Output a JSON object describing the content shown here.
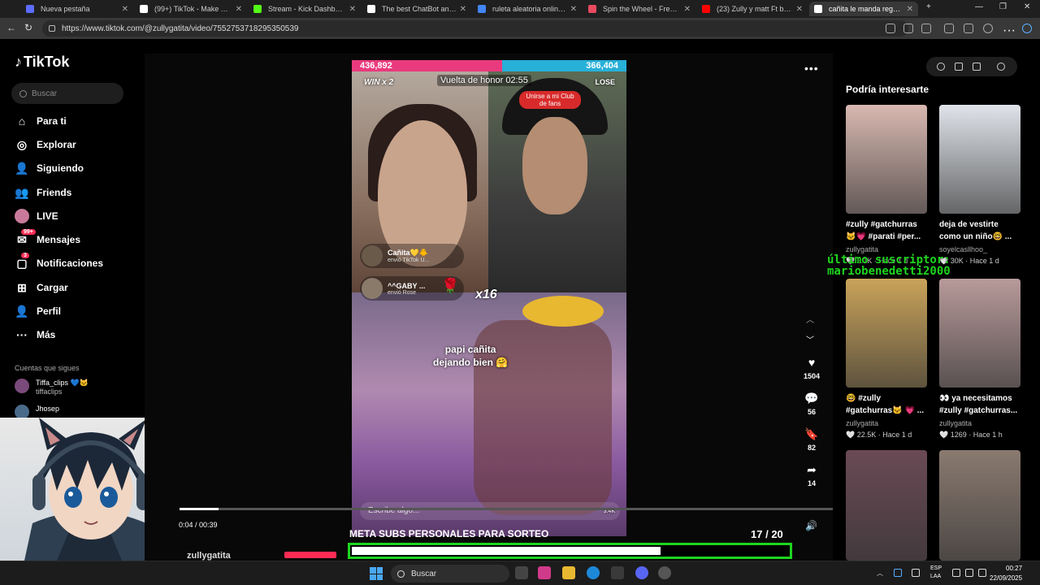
{
  "browser": {
    "tabs": [
      {
        "label": "Nueva pestaña",
        "color": "#5b6cff"
      },
      {
        "label": "(99+) TikTok - Make Your Da",
        "color": "#ffffff"
      },
      {
        "label": "Stream - Kick Dashboard",
        "color": "#53fc18"
      },
      {
        "label": "The best ChatBot and Widg",
        "color": "#ffffff"
      },
      {
        "label": "ruleta aleatoria online - Bú",
        "color": "#4285f4"
      },
      {
        "label": "Spin the Wheel - Free and",
        "color": "#e84a5f"
      },
      {
        "label": "(23) Zully y matt Ft baile in",
        "color": "#ff0000"
      },
      {
        "label": "cañita le manda regalos a",
        "color": "#ffffff"
      }
    ],
    "new_tab": "+",
    "url": "https://www.tiktok.com/@zullygatita/video/7552753718295350539"
  },
  "tiktok": {
    "logo": "TikTok",
    "search_placeholder": "Buscar",
    "nav": [
      {
        "label": "Para ti",
        "icon": "home-icon",
        "glyph": "⌂"
      },
      {
        "label": "Explorar",
        "icon": "compass-icon",
        "glyph": "◎"
      },
      {
        "label": "Siguiendo",
        "icon": "following-icon",
        "glyph": "👤"
      },
      {
        "label": "Friends",
        "icon": "friends-icon",
        "glyph": "👥"
      },
      {
        "label": "LIVE",
        "icon": "live-icon",
        "glyph": "●"
      },
      {
        "label": "Mensajes",
        "icon": "messages-icon",
        "glyph": "✉",
        "badge": "99+"
      },
      {
        "label": "Notificaciones",
        "icon": "bell-icon",
        "glyph": "▢",
        "badge": "3"
      },
      {
        "label": "Cargar",
        "icon": "upload-icon",
        "glyph": "⊞"
      },
      {
        "label": "Perfil",
        "icon": "profile-icon",
        "glyph": "👤"
      },
      {
        "label": "Más",
        "icon": "more-icon",
        "glyph": "···"
      }
    ],
    "following_header": "Cuentas que sigues",
    "following": [
      {
        "name": "Tiffa_clips 💙🐱",
        "handle": "tiffaclips"
      },
      {
        "name": "Jhosep",
        "handle": ""
      }
    ]
  },
  "video": {
    "score_left": "436,892",
    "score_right": "366,404",
    "win_label": "WIN x 2",
    "lose_label": "LOSE",
    "honor_label": "Vuelta de honor 02:55",
    "club_label": "Unirse a mi Club de fans",
    "gifts": [
      {
        "name": "Cañita💛🐥",
        "sub": "envió TikTok U..."
      },
      {
        "name": "^^GABY ...",
        "sub": "envió Rose"
      }
    ],
    "multiplier": "x16",
    "caption_line1": "papi cañita",
    "caption_line2": "dejando bien 🤗",
    "comment_placeholder": "Escribe algo...",
    "view_count": "3.4K",
    "progress_fraction": 0.06,
    "timecode": "0:04 / 00:39",
    "username": "zullygatita",
    "actions": [
      {
        "icon": "heart-icon",
        "glyph": "♥",
        "count": "1504"
      },
      {
        "icon": "comment-icon",
        "glyph": "💬",
        "count": "56"
      },
      {
        "icon": "bookmark-icon",
        "glyph": "🔖",
        "count": "82"
      },
      {
        "icon": "share-icon",
        "glyph": "➦",
        "count": "14"
      }
    ]
  },
  "goal": {
    "title": "META SUBS PERSONALES PARA SORTEO",
    "current": "17",
    "target": "/ 20",
    "fraction": 0.85,
    "color": "#1ed51e"
  },
  "recommendations": {
    "header": "Podría interesarte",
    "cards": [
      {
        "title": "#zully #gatchurras 🐱💗 #parati #per...",
        "user": "zullygatita",
        "meta": "🤍 3.1K · Hace 1 d",
        "color": "#d8b8b0"
      },
      {
        "title": "deja de vestirte como un niño🤓 ...",
        "user": "soyelcasllhoo_",
        "meta": "🤍 30K · Hace 1 d",
        "color": "#e0e4ea"
      },
      {
        "title": "🤓 #zully #gatchurras🐱 💗 ...",
        "user": "zullygatita",
        "meta": "🤍 22.5K · Hace 1 d",
        "color": "#c9a35a"
      },
      {
        "title": "👀 ya necesitamos #zully #gatchurras...",
        "user": "zullygatita",
        "meta": "🤍 1269 · Hace 1 h",
        "color": "#b89a9a"
      },
      {
        "title": "",
        "user": "",
        "meta": "",
        "color": "#6a4a55"
      },
      {
        "title": "",
        "user": "",
        "meta": "",
        "color": "#8a7a70"
      }
    ]
  },
  "overlay": {
    "last_sub_line1": "último suscriptor:",
    "last_sub_line2": "mariobenedetti2000"
  },
  "taskbar": {
    "search": "Buscar",
    "lang_line1": "ESP",
    "lang_line2": "LAA",
    "time": "00:27",
    "date": "22/09/2025"
  }
}
